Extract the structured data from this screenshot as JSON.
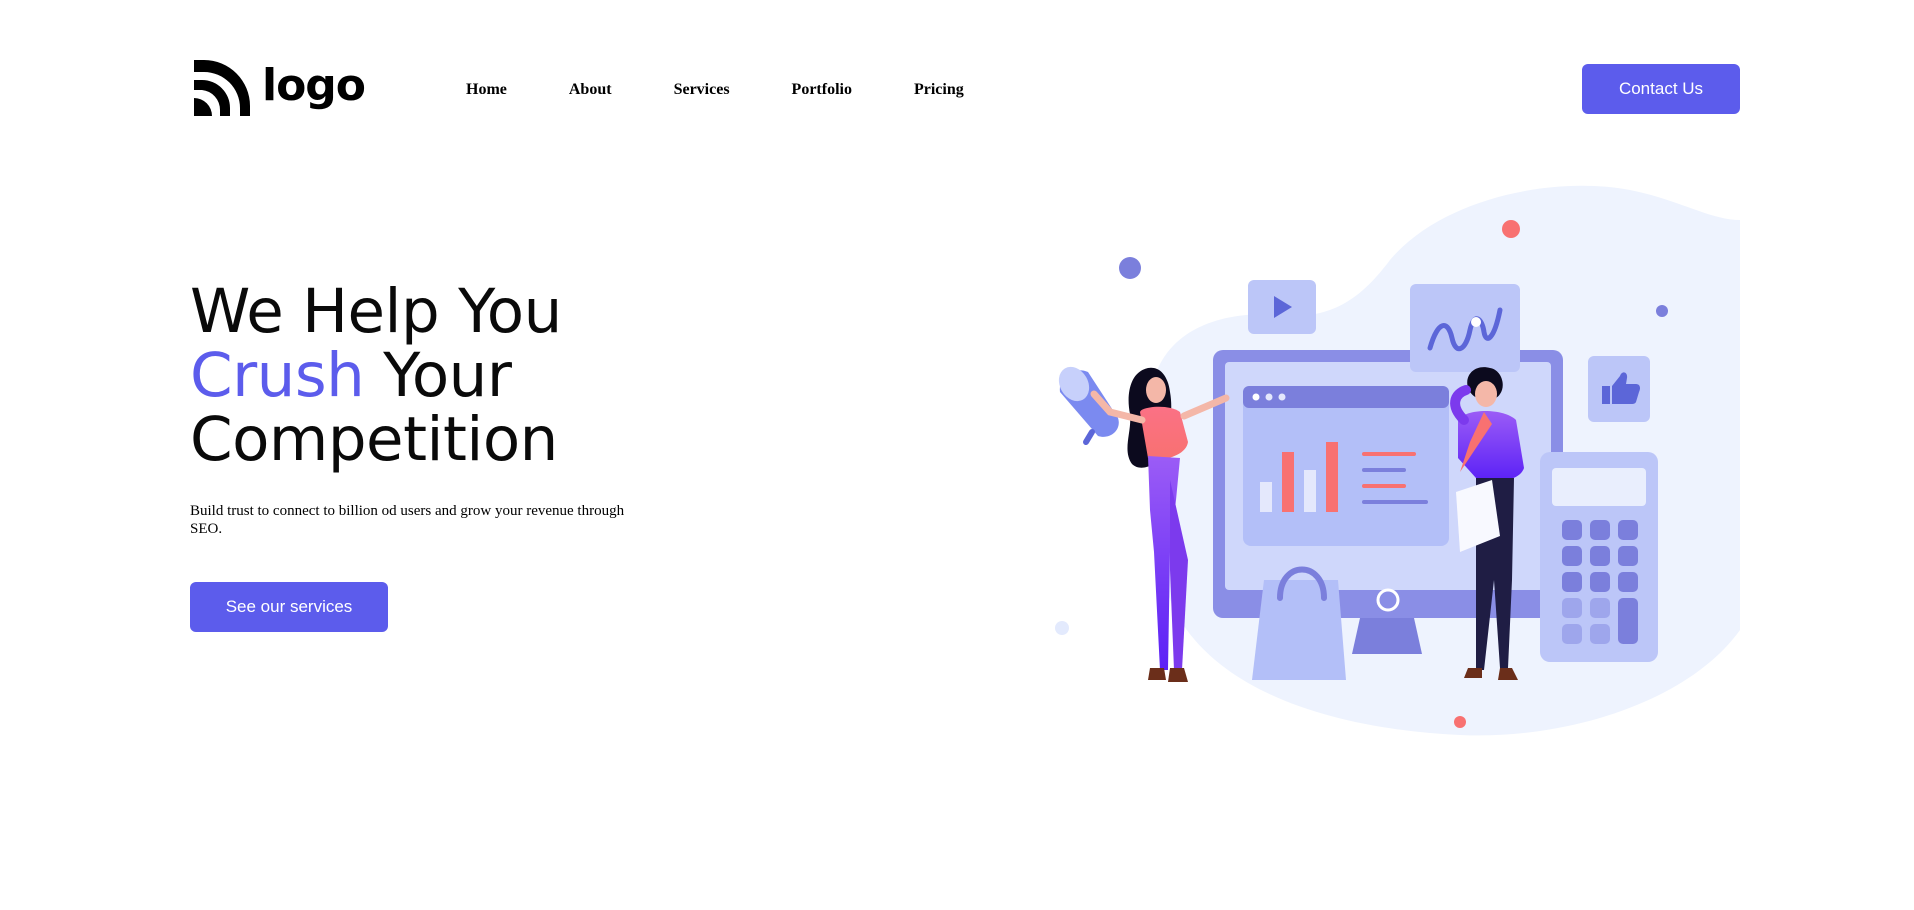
{
  "header": {
    "logo_text": "logo",
    "nav": [
      {
        "label": "Home"
      },
      {
        "label": "About"
      },
      {
        "label": "Services"
      },
      {
        "label": "Portfolio"
      },
      {
        "label": "Pricing"
      }
    ],
    "contact_label": "Contact Us"
  },
  "hero": {
    "title_line1": "We Help You",
    "title_accent": "Crush",
    "title_line2_rest": " Your",
    "title_line3": "Competition",
    "subtitle": "Build trust to connect to billion od users and grow your revenue through SEO.",
    "cta_label": "See our services"
  },
  "colors": {
    "accent": "#5c5cec",
    "illus_blue": "#7b7fdc",
    "illus_light": "#bcc6f8",
    "illus_pink": "#f87171",
    "blob": "#eef3fe"
  },
  "icons": {
    "logo": "signal-arcs-icon",
    "illustration": "marketing-team-illustration"
  }
}
